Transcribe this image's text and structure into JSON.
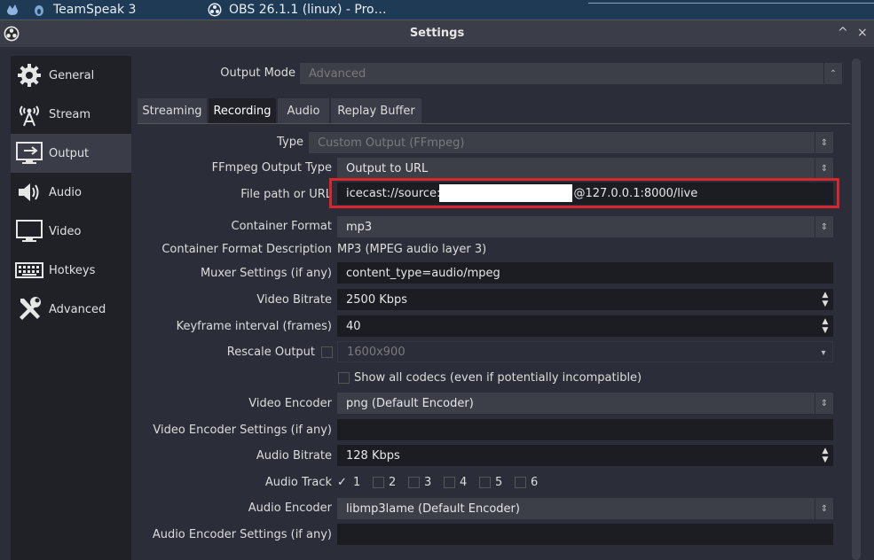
{
  "taskbar": {
    "items": [
      {
        "label": "TeamSpeak 3"
      },
      {
        "label": "OBS 26.1.1 (linux) - Pro…"
      }
    ]
  },
  "window": {
    "title": "Settings",
    "minimize": "^",
    "close": "×"
  },
  "sidebar": {
    "items": [
      {
        "label": "General",
        "icon": "gear-icon"
      },
      {
        "label": "Stream",
        "icon": "antenna-icon"
      },
      {
        "label": "Output",
        "icon": "output-monitor-icon",
        "active": true
      },
      {
        "label": "Audio",
        "icon": "speaker-icon"
      },
      {
        "label": "Video",
        "icon": "monitor-icon"
      },
      {
        "label": "Hotkeys",
        "icon": "keyboard-icon"
      },
      {
        "label": "Advanced",
        "icon": "tools-icon"
      }
    ]
  },
  "output": {
    "mode_label": "Output Mode",
    "mode_value": "Advanced",
    "tabs": [
      "Streaming",
      "Recording",
      "Audio",
      "Replay Buffer"
    ],
    "active_tab": "Recording"
  },
  "form": {
    "type": {
      "label": "Type",
      "value": "Custom Output (FFmpeg)"
    },
    "ffmpeg_output_type": {
      "label": "FFmpeg Output Type",
      "value": "Output to URL"
    },
    "file_path": {
      "label": "File path or URL",
      "value_prefix": "icecast://source:",
      "value_suffix": "@127.0.0.1:8000/live"
    },
    "container_format": {
      "label": "Container Format",
      "value": "mp3"
    },
    "container_desc": {
      "label": "Container Format Description",
      "value": "MP3 (MPEG audio layer 3)"
    },
    "muxer": {
      "label": "Muxer Settings (if any)",
      "value": "content_type=audio/mpeg"
    },
    "video_bitrate": {
      "label": "Video Bitrate",
      "value": "2500 Kbps"
    },
    "keyframe": {
      "label": "Keyframe interval (frames)",
      "value": "40"
    },
    "rescale": {
      "label": "Rescale Output",
      "value": "1600x900"
    },
    "show_codecs": {
      "label": "Show all codecs (even if potentially incompatible)"
    },
    "video_encoder": {
      "label": "Video Encoder",
      "value": "png (Default Encoder)"
    },
    "video_encoder_settings": {
      "label": "Video Encoder Settings (if any)",
      "value": ""
    },
    "audio_bitrate": {
      "label": "Audio Bitrate",
      "value": "128 Kbps"
    },
    "audio_track": {
      "label": "Audio Track",
      "tracks": [
        "1",
        "2",
        "3",
        "4",
        "5",
        "6"
      ],
      "checked": "1"
    },
    "audio_encoder": {
      "label": "Audio Encoder",
      "value": "libmp3lame (Default Encoder)"
    },
    "audio_encoder_settings": {
      "label": "Audio Encoder Settings (if any)",
      "value": ""
    }
  },
  "colors": {
    "highlight_border": "#d8262c",
    "background": "#2b2e38",
    "sidebar": "#1f2127"
  }
}
